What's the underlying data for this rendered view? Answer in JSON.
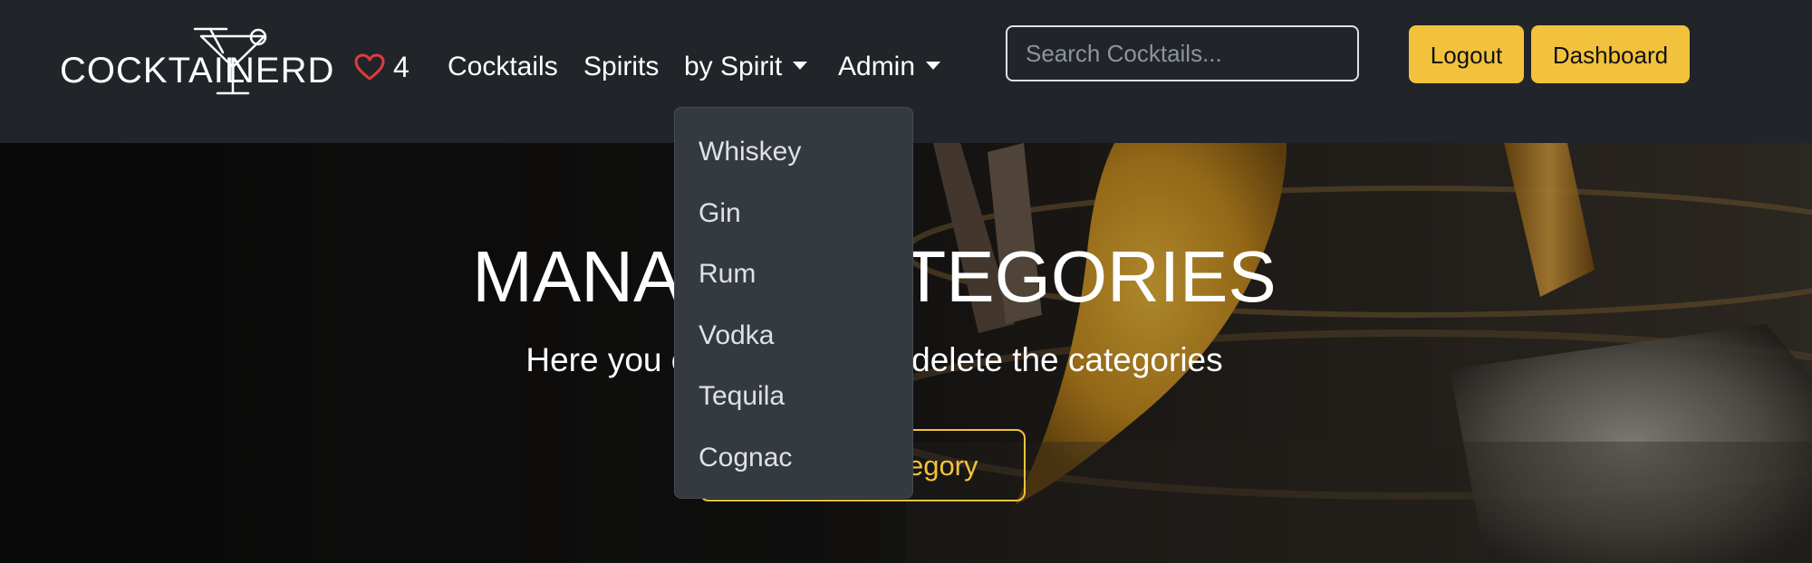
{
  "brand": {
    "left": "COCKTAIL",
    "right": "NERD"
  },
  "favorites": {
    "icon": "heart-outline-icon",
    "count": "4"
  },
  "nav": {
    "cocktails": "Cocktails",
    "spirits": "Spirits",
    "by_spirit": "by Spirit",
    "admin": "Admin"
  },
  "search": {
    "placeholder": "Search Cocktails..."
  },
  "buttons": {
    "logout": "Logout",
    "dashboard": "Dashboard"
  },
  "dropdown": {
    "items": [
      "Whiskey",
      "Gin",
      "Rum",
      "Vodka",
      "Tequila",
      "Cognac"
    ]
  },
  "hero": {
    "title": "MANAGE CATEGORIES",
    "subtitle": "Here you can add, edit or delete the categories",
    "button": "Add new Category"
  },
  "colors": {
    "navbar": "#212529",
    "accent": "#f3c23d",
    "heart": "#e03b3b",
    "dropdown": "#343a40"
  }
}
